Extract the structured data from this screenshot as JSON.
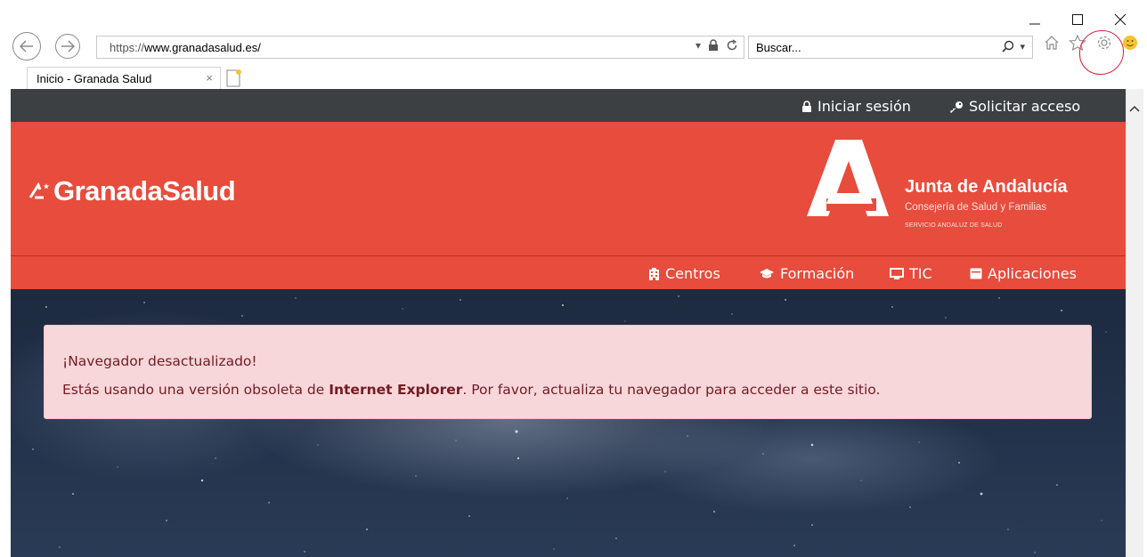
{
  "browser": {
    "url_protocol": "https://",
    "url_host": "www.granadasalud.es/",
    "search_placeholder": "Buscar...",
    "tab_title": "Inicio - Granada Salud",
    "tab_close": "×"
  },
  "topbar": {
    "login_label": "Iniciar sesión",
    "request_access_label": "Solicitar acceso"
  },
  "header": {
    "brand_name": "GranadaSalud",
    "org_title": "Junta de Andalucía",
    "org_subtitle": "Consejería de Salud y Familias",
    "org_service": "SERVICIO ANDALUZ DE SALUD"
  },
  "nav": {
    "items": [
      {
        "label": "Centros",
        "icon": "building-icon"
      },
      {
        "label": "Formación",
        "icon": "graduation-cap-icon"
      },
      {
        "label": "TIC",
        "icon": "monitor-icon"
      },
      {
        "label": "Aplicaciones",
        "icon": "window-icon"
      }
    ]
  },
  "alert": {
    "title": "¡Navegador desactualizado!",
    "text_before": "Estás usando una versión obsoleta de ",
    "browser_name": "Internet Explorer",
    "text_after": ". Por favor, actualiza tu navegador para acceder a este sitio."
  },
  "colors": {
    "brand_red": "#e74c3c",
    "topbar_dark": "#3c4043",
    "alert_bg": "#f8d7da",
    "alert_text": "#721c24",
    "annotation_red": "#e0203a"
  }
}
